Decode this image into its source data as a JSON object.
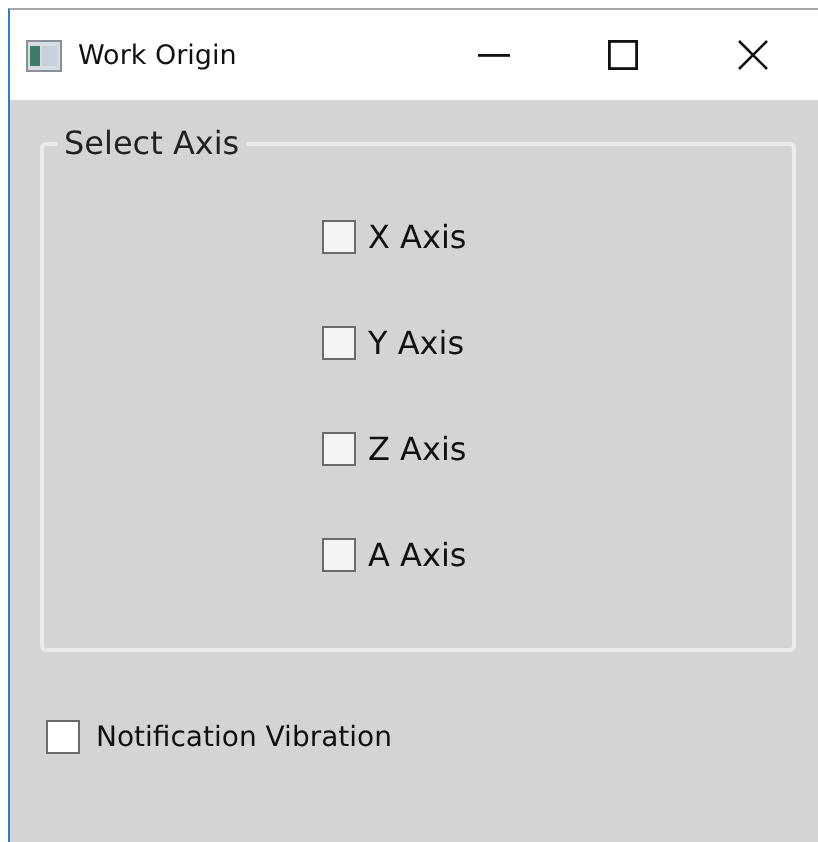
{
  "window": {
    "title": "Work Origin"
  },
  "group": {
    "title": "Select Axis",
    "checkboxes": [
      {
        "label": "X Axis",
        "checked": false
      },
      {
        "label": "Y Axis",
        "checked": false
      },
      {
        "label": "Z Axis",
        "checked": false
      },
      {
        "label": "A Axis",
        "checked": false
      }
    ]
  },
  "options": [
    {
      "label": "Notification Vibration",
      "checked": false
    }
  ]
}
